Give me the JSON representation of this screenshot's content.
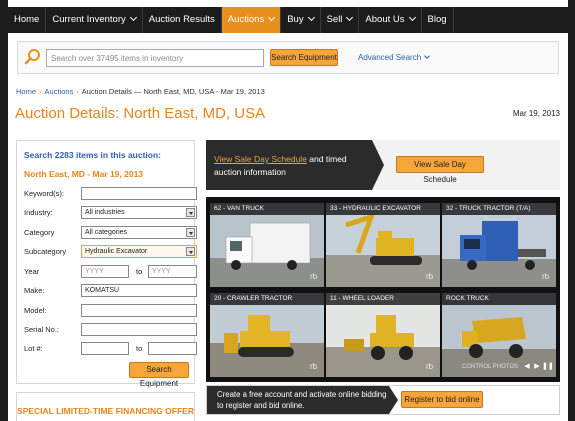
{
  "nav": {
    "items": [
      {
        "label": "Home",
        "chevron": false,
        "active": false
      },
      {
        "label": "Current Inventory",
        "chevron": true,
        "active": false
      },
      {
        "label": "Auction Results",
        "chevron": false,
        "active": false
      },
      {
        "label": "Auctions",
        "chevron": true,
        "active": true
      },
      {
        "label": "Buy",
        "chevron": true,
        "active": false
      },
      {
        "label": "Sell",
        "chevron": true,
        "active": false
      },
      {
        "label": "About Us",
        "chevron": true,
        "active": false
      },
      {
        "label": "Blog",
        "chevron": false,
        "active": false
      }
    ]
  },
  "search": {
    "placeholder": "Search over 37495 items in inventory",
    "button": "Search Equipment",
    "advanced": "Advanced Search"
  },
  "breadcrumb": {
    "home": "Home",
    "auctions": "Auctions",
    "current": "Auction Details — North East, MD, USA - Mar 19, 2013"
  },
  "page": {
    "title": "Auction Details: North East, MD, USA",
    "date": "Mar 19, 2013"
  },
  "filter": {
    "heading": "Search 2283 items in this auction:",
    "subheading": "North East, MD - Mar 19, 2013",
    "keywords_label": "Keyword(s):",
    "industry_label": "Industry:",
    "industry_value": "All industries",
    "category_label": "Category",
    "category_value": "All categories",
    "subcategory_label": "Subcategory",
    "subcategory_value": "Hydraulic Excavator",
    "year_label": "Year",
    "year_from_placeholder": "YYYY",
    "year_to_placeholder": "YYYY",
    "to": "to",
    "make_label": "Make:",
    "make_value": "KOMATSU",
    "model_label": "Model:",
    "serial_label": "Serial No.:",
    "lot_label": "Lot #:",
    "button": "Search Equipment"
  },
  "promo": {
    "text": "SPECIAL LIMITED-TIME FINANCING OFFER"
  },
  "banner": {
    "link": "View Sale Day Schedule",
    "rest": " and timed auction information",
    "button": "View Sale Day Schedule"
  },
  "gallery": {
    "tiles": [
      {
        "caption": "62 - VAN TRUCK",
        "icon": "box-truck-photo"
      },
      {
        "caption": "33 - HYDRAULIC EXCAVATOR",
        "icon": "excavator-photo"
      },
      {
        "caption": "32 - TRUCK TRACTOR (T/A)",
        "icon": "semi-truck-photo"
      },
      {
        "caption": "20 - CRAWLER TRACTOR",
        "icon": "bulldozer-photo"
      },
      {
        "caption": "11 - WHEEL LOADER",
        "icon": "wheel-loader-photo"
      },
      {
        "caption": "ROCK TRUCK",
        "icon": "rock-truck-photo"
      }
    ],
    "controls_label": "CONTROL PHOTOS"
  },
  "register": {
    "text": "Create a free account and activate online bidding to register and bid online.",
    "button": "Register to bid online"
  },
  "colors": {
    "accent": "#e8901e",
    "link": "#2e5fa8",
    "nav_bg": "#1c1c1c"
  }
}
